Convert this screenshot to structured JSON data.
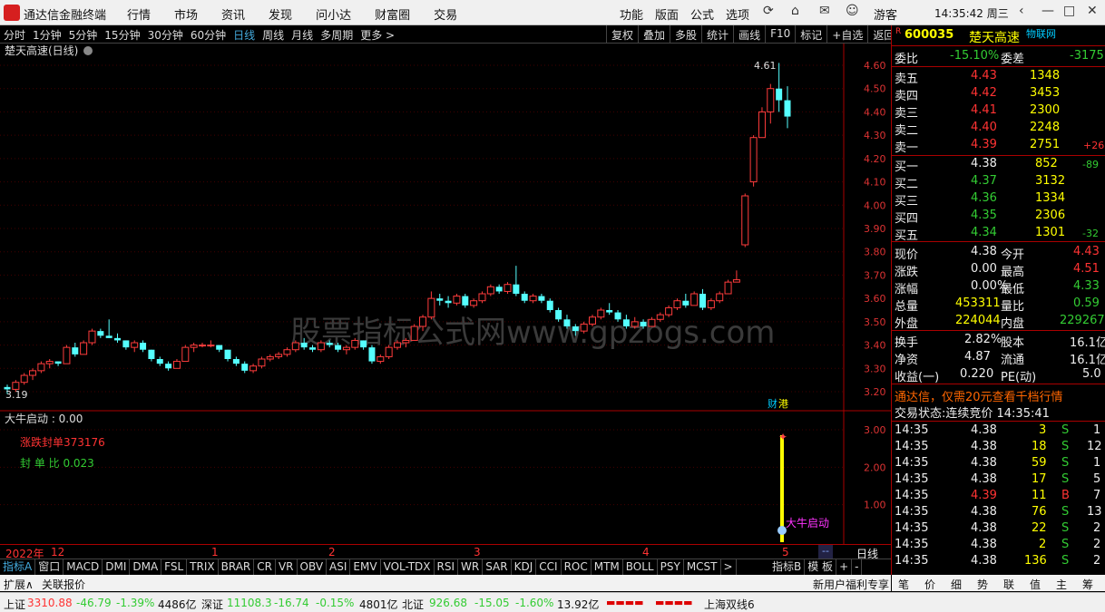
{
  "app": {
    "title": "通达信金融终端",
    "menus": [
      "行情",
      "市场",
      "资讯",
      "发现",
      "问小达",
      "财富圈",
      "交易"
    ],
    "tools": [
      "功能",
      "版面",
      "公式",
      "选项"
    ],
    "guest": "游客",
    "time": "14:35:42 周三"
  },
  "periods": {
    "items": [
      "分时",
      "1分钟",
      "5分钟",
      "15分钟",
      "30分钟",
      "60分钟",
      "日线",
      "周线",
      "月线",
      "多周期",
      "更多 >"
    ],
    "active": "日线"
  },
  "right_tools": [
    "复权",
    "叠加",
    "多股",
    "统计",
    "画线",
    "F10",
    "标记",
    "+自选",
    "返回"
  ],
  "chart": {
    "name": "楚天高速(日线)",
    "high_label": "4.61",
    "low_label": "3.19",
    "price_ticks": [
      "4.60",
      "4.50",
      "4.40",
      "4.30",
      "4.20",
      "4.10",
      "4.00",
      "3.90",
      "3.80",
      "3.70",
      "3.60",
      "3.50",
      "3.40",
      "3.30",
      "3.20"
    ],
    "cai_label": "财",
    "gang_label": "港",
    "watermark": "股票指标公式网www.gpzbgs.com",
    "x_labels": [
      "2022年",
      "12",
      "1",
      "2",
      "3",
      "4",
      "5"
    ],
    "x_end_label": "日线"
  },
  "indicator": {
    "title": "大牛启动 : 0.00",
    "line1": "涨跌封单373176",
    "line2": "封 单 比  0.023",
    "ticks": [
      "3.00",
      "2.00",
      "1.00"
    ],
    "signal_label": "大牛启动"
  },
  "quote": {
    "code": "600035",
    "name": "楚天高速",
    "badge": "物联网",
    "r_mark": "R",
    "weibi_label": "委比",
    "weibi": "-15.10%",
    "weicha_label": "委差",
    "weicha": "-3175",
    "asks": [
      {
        "label": "卖五",
        "price": "4.43",
        "vol": "1348",
        "chg": ""
      },
      {
        "label": "卖四",
        "price": "4.42",
        "vol": "3453",
        "chg": ""
      },
      {
        "label": "卖三",
        "price": "4.41",
        "vol": "2300",
        "chg": ""
      },
      {
        "label": "卖二",
        "price": "4.40",
        "vol": "2248",
        "chg": ""
      },
      {
        "label": "卖一",
        "price": "4.39",
        "vol": "2751",
        "chg": "+26"
      }
    ],
    "bids": [
      {
        "label": "买一",
        "price": "4.38",
        "vol": "852",
        "chg": "-89"
      },
      {
        "label": "买二",
        "price": "4.37",
        "vol": "3132",
        "chg": ""
      },
      {
        "label": "买三",
        "price": "4.36",
        "vol": "1334",
        "chg": ""
      },
      {
        "label": "买四",
        "price": "4.35",
        "vol": "2306",
        "chg": ""
      },
      {
        "label": "买五",
        "price": "4.34",
        "vol": "1301",
        "chg": "-32"
      }
    ],
    "stats": [
      {
        "l1": "现价",
        "v1": "4.38",
        "l2": "今开",
        "v2": "4.43"
      },
      {
        "l1": "涨跌",
        "v1": "0.00",
        "l2": "最高",
        "v2": "4.51"
      },
      {
        "l1": "涨幅",
        "v1": "0.00%",
        "l2": "最低",
        "v2": "4.33"
      },
      {
        "l1": "总量",
        "v1": "453311",
        "l2": "量比",
        "v2": "0.59"
      },
      {
        "l1": "外盘",
        "v1": "224044",
        "l2": "内盘",
        "v2": "229267"
      }
    ],
    "stats2": [
      {
        "l1": "换手",
        "v1": "2.82%",
        "l2": "股本",
        "v2": "16.1亿"
      },
      {
        "l1": "净资",
        "v1": "4.87",
        "l2": "流通",
        "v2": "16.1亿"
      },
      {
        "l1": "收益(一)",
        "v1": "0.220",
        "l2": "PE(动)",
        "v2": "5.0"
      }
    ],
    "promo": "通达信，仅需20元查看千档行情",
    "trade_state": "交易状态:连续竞价 14:35:41",
    "ticks": [
      {
        "t": "14:35",
        "p": "4.38",
        "v": "3",
        "d": "S",
        "n": "1"
      },
      {
        "t": "14:35",
        "p": "4.38",
        "v": "18",
        "d": "S",
        "n": "12"
      },
      {
        "t": "14:35",
        "p": "4.38",
        "v": "59",
        "d": "S",
        "n": "1"
      },
      {
        "t": "14:35",
        "p": "4.38",
        "v": "17",
        "d": "S",
        "n": "5"
      },
      {
        "t": "14:35",
        "p": "4.39",
        "v": "11",
        "d": "B",
        "n": "7"
      },
      {
        "t": "14:35",
        "p": "4.38",
        "v": "76",
        "d": "S",
        "n": "13"
      },
      {
        "t": "14:35",
        "p": "4.38",
        "v": "22",
        "d": "S",
        "n": "2"
      },
      {
        "t": "14:35",
        "p": "4.38",
        "v": "2",
        "d": "S",
        "n": "2"
      },
      {
        "t": "14:35",
        "p": "4.38",
        "v": "136",
        "d": "S",
        "n": "2"
      }
    ]
  },
  "index_tabs": [
    "指标A",
    "窗口",
    "MACD",
    "DMI",
    "DMA",
    "FSL",
    "TRIX",
    "BRAR",
    "CR",
    "VR",
    "OBV",
    "ASI",
    "EMV",
    "VOL-TDX",
    "RSI",
    "WR",
    "SAR",
    "KDJ",
    "CCI",
    "ROC",
    "MTM",
    "BOLL",
    "PSY",
    "MCST",
    ">"
  ],
  "index_right": [
    "指标B",
    "模 板",
    "+",
    "-"
  ],
  "ext": {
    "expand": "扩展∧",
    "news": "关联报价",
    "promo": "新用户福利专享"
  },
  "quote_tabs": [
    "笔",
    "价",
    "细",
    "势",
    "联",
    "值",
    "主",
    "筹"
  ],
  "status": {
    "sh": "上证",
    "sh_v": "3310.88",
    "sh_c": "-46.79",
    "sh_p": "-1.39%",
    "sh_a": "4486亿",
    "sz": "深证",
    "sz_v": "11108.3",
    "sz_c": "-16.74",
    "sz_p": "-0.15%",
    "sz_a": "4801亿",
    "bz": "北证",
    "bz_v": "926.68",
    "bz_c": "-15.05",
    "bz_p": "-1.60%",
    "bz_a": "13.92亿",
    "line": "上海双线6"
  },
  "candles": [
    [
      3.22,
      3.23,
      3.19,
      3.21
    ],
    [
      3.21,
      3.25,
      3.2,
      3.24
    ],
    [
      3.24,
      3.28,
      3.23,
      3.27
    ],
    [
      3.27,
      3.3,
      3.25,
      3.29
    ],
    [
      3.29,
      3.33,
      3.28,
      3.32
    ],
    [
      3.32,
      3.34,
      3.3,
      3.33
    ],
    [
      3.33,
      3.33,
      3.31,
      3.32
    ],
    [
      3.32,
      3.4,
      3.32,
      3.39
    ],
    [
      3.39,
      3.41,
      3.35,
      3.36
    ],
    [
      3.36,
      3.42,
      3.36,
      3.41
    ],
    [
      3.41,
      3.47,
      3.4,
      3.46
    ],
    [
      3.46,
      3.47,
      3.43,
      3.44
    ],
    [
      3.44,
      3.51,
      3.44,
      3.43
    ],
    [
      3.43,
      3.45,
      3.41,
      3.42
    ],
    [
      3.42,
      3.42,
      3.38,
      3.39
    ],
    [
      3.39,
      3.42,
      3.37,
      3.41
    ],
    [
      3.41,
      3.42,
      3.37,
      3.38
    ],
    [
      3.38,
      3.38,
      3.33,
      3.34
    ],
    [
      3.34,
      3.35,
      3.31,
      3.32
    ],
    [
      3.32,
      3.33,
      3.29,
      3.3
    ],
    [
      3.3,
      3.34,
      3.3,
      3.33
    ],
    [
      3.33,
      3.4,
      3.33,
      3.39
    ],
    [
      3.39,
      3.41,
      3.37,
      3.4
    ],
    [
      3.4,
      3.41,
      3.39,
      3.4
    ],
    [
      3.4,
      3.42,
      3.39,
      3.4
    ],
    [
      3.4,
      3.4,
      3.37,
      3.38
    ],
    [
      3.38,
      3.38,
      3.33,
      3.34
    ],
    [
      3.34,
      3.35,
      3.31,
      3.32
    ],
    [
      3.32,
      3.33,
      3.28,
      3.29
    ],
    [
      3.29,
      3.32,
      3.28,
      3.31
    ],
    [
      3.31,
      3.35,
      3.3,
      3.34
    ],
    [
      3.34,
      3.36,
      3.33,
      3.35
    ],
    [
      3.35,
      3.37,
      3.34,
      3.36
    ],
    [
      3.36,
      3.39,
      3.35,
      3.38
    ],
    [
      3.38,
      3.42,
      3.37,
      3.41
    ],
    [
      3.41,
      3.43,
      3.38,
      3.39
    ],
    [
      3.39,
      3.4,
      3.37,
      3.38
    ],
    [
      3.38,
      3.42,
      3.37,
      3.41
    ],
    [
      3.41,
      3.42,
      3.39,
      3.4
    ],
    [
      3.4,
      3.41,
      3.37,
      3.38
    ],
    [
      3.38,
      3.4,
      3.36,
      3.39
    ],
    [
      3.39,
      3.43,
      3.38,
      3.42
    ],
    [
      3.42,
      3.42,
      3.38,
      3.39
    ],
    [
      3.39,
      3.4,
      3.32,
      3.33
    ],
    [
      3.33,
      3.36,
      3.32,
      3.35
    ],
    [
      3.35,
      3.4,
      3.34,
      3.39
    ],
    [
      3.39,
      3.42,
      3.38,
      3.41
    ],
    [
      3.41,
      3.43,
      3.39,
      3.42
    ],
    [
      3.42,
      3.49,
      3.42,
      3.48
    ],
    [
      3.48,
      3.53,
      3.46,
      3.52
    ],
    [
      3.52,
      3.63,
      3.51,
      3.6
    ],
    [
      3.6,
      3.62,
      3.57,
      3.59
    ],
    [
      3.59,
      3.61,
      3.56,
      3.58
    ],
    [
      3.58,
      3.62,
      3.57,
      3.61
    ],
    [
      3.61,
      3.62,
      3.56,
      3.57
    ],
    [
      3.57,
      3.6,
      3.56,
      3.59
    ],
    [
      3.59,
      3.63,
      3.58,
      3.62
    ],
    [
      3.62,
      3.66,
      3.61,
      3.65
    ],
    [
      3.65,
      3.66,
      3.62,
      3.63
    ],
    [
      3.63,
      3.67,
      3.62,
      3.66
    ],
    [
      3.66,
      3.74,
      3.61,
      3.62
    ],
    [
      3.62,
      3.63,
      3.58,
      3.59
    ],
    [
      3.59,
      3.62,
      3.58,
      3.61
    ],
    [
      3.61,
      3.62,
      3.58,
      3.59
    ],
    [
      3.59,
      3.6,
      3.54,
      3.55
    ],
    [
      3.55,
      3.56,
      3.5,
      3.51
    ],
    [
      3.51,
      3.53,
      3.47,
      3.48
    ],
    [
      3.48,
      3.49,
      3.44,
      3.46
    ],
    [
      3.46,
      3.5,
      3.45,
      3.49
    ],
    [
      3.49,
      3.53,
      3.48,
      3.52
    ],
    [
      3.52,
      3.56,
      3.51,
      3.55
    ],
    [
      3.55,
      3.58,
      3.53,
      3.54
    ],
    [
      3.54,
      3.55,
      3.5,
      3.51
    ],
    [
      3.51,
      3.53,
      3.47,
      3.48
    ],
    [
      3.48,
      3.52,
      3.47,
      3.5
    ],
    [
      3.5,
      3.51,
      3.47,
      3.48
    ],
    [
      3.48,
      3.52,
      3.48,
      3.51
    ],
    [
      3.51,
      3.54,
      3.5,
      3.53
    ],
    [
      3.53,
      3.57,
      3.52,
      3.56
    ],
    [
      3.56,
      3.6,
      3.55,
      3.59
    ],
    [
      3.59,
      3.62,
      3.56,
      3.57
    ],
    [
      3.57,
      3.63,
      3.57,
      3.62
    ],
    [
      3.62,
      3.64,
      3.55,
      3.56
    ],
    [
      3.56,
      3.6,
      3.55,
      3.59
    ],
    [
      3.59,
      3.63,
      3.58,
      3.62
    ],
    [
      3.62,
      3.68,
      3.62,
      3.67
    ],
    [
      3.67,
      3.72,
      3.8,
      3.68
    ],
    [
      3.83,
      4.05,
      3.82,
      4.04
    ],
    [
      4.1,
      4.3,
      4.08,
      4.29
    ],
    [
      4.29,
      4.42,
      4.29,
      4.4
    ],
    [
      4.4,
      4.52,
      4.35,
      4.5
    ],
    [
      4.5,
      4.61,
      4.4,
      4.45
    ],
    [
      4.45,
      4.51,
      4.33,
      4.38
    ]
  ]
}
